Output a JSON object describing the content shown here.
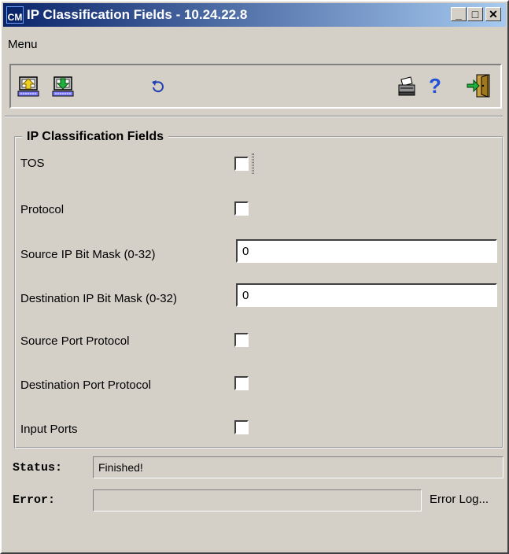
{
  "window": {
    "title": "IP Classification Fields - 10.24.22.8",
    "app_icon_text": "CM",
    "min_glyph": "_",
    "max_glyph": "□",
    "close_glyph": "✕"
  },
  "menubar": {
    "menu_label": "Menu"
  },
  "toolbar": {
    "icons": [
      "upload-icon",
      "download-icon",
      "undo-icon",
      "printer-icon",
      "help-icon",
      "exit-icon"
    ],
    "help_glyph": "?"
  },
  "group": {
    "legend": "IP Classification Fields",
    "fields": {
      "tos": {
        "label": "TOS",
        "checked": false
      },
      "protocol": {
        "label": "Protocol",
        "checked": false
      },
      "source_ip_mask": {
        "label": "Source IP Bit Mask (0-32)",
        "value": "0"
      },
      "dest_ip_mask": {
        "label": "Destination IP Bit Mask (0-32)",
        "value": "0"
      },
      "source_port_protocol": {
        "label": "Source Port Protocol",
        "checked": false
      },
      "dest_port_protocol": {
        "label": "Destination Port Protocol",
        "checked": false
      },
      "input_ports": {
        "label": "Input Ports",
        "checked": false
      }
    }
  },
  "status": {
    "status_label": "Status:",
    "status_value": "Finished!",
    "error_label": "Error:",
    "error_value": "",
    "error_log_label": "Error Log..."
  },
  "colors": {
    "window_bg": "#d4d0c8",
    "title_start": "#0a246a",
    "title_end": "#a6caf0",
    "help_blue": "#1f4fd8"
  }
}
